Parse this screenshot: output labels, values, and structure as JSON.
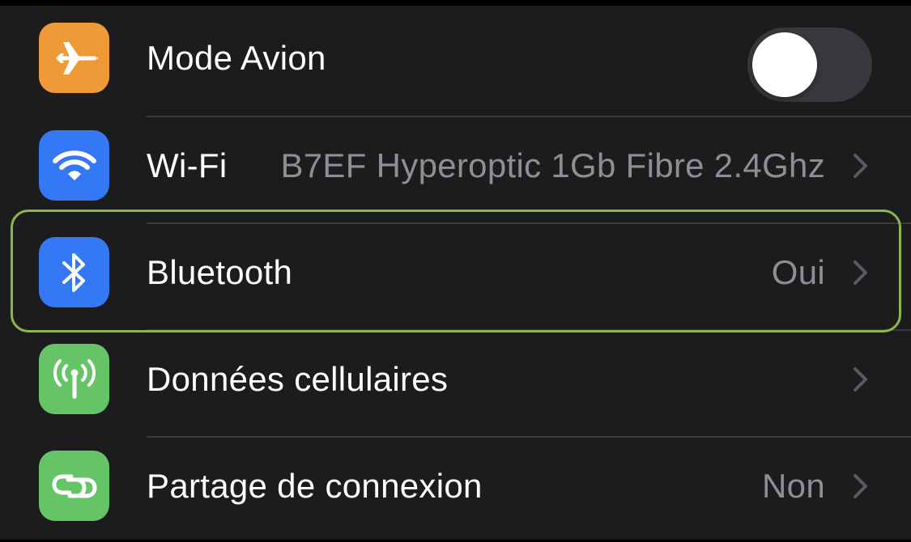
{
  "settings": {
    "rows": [
      {
        "label": "Mode Avion",
        "icon": "airplane-icon",
        "icon_color": "#f09a37",
        "control": "toggle",
        "toggle_on": false
      },
      {
        "label": "Wi-Fi",
        "value": "B7EF Hyperoptic 1Gb Fibre 2.4Ghz",
        "icon": "wifi-icon",
        "icon_color": "#3478f6"
      },
      {
        "label": "Bluetooth",
        "value": "Oui",
        "icon": "bluetooth-icon",
        "icon_color": "#3478f6",
        "highlighted": true
      },
      {
        "label": "Données cellulaires",
        "icon": "cellular-antenna-icon",
        "icon_color": "#65c466"
      },
      {
        "label": "Partage de connexion",
        "value": "Non",
        "icon": "personal-hotspot-icon",
        "icon_color": "#65c466"
      }
    ]
  },
  "colors": {
    "background": "#1c1c1e",
    "label": "#ffffff",
    "value": "#8e8e93",
    "separator": "#3a3a3c",
    "highlight": "#8cb84a",
    "toggle_off": "#39393d"
  }
}
